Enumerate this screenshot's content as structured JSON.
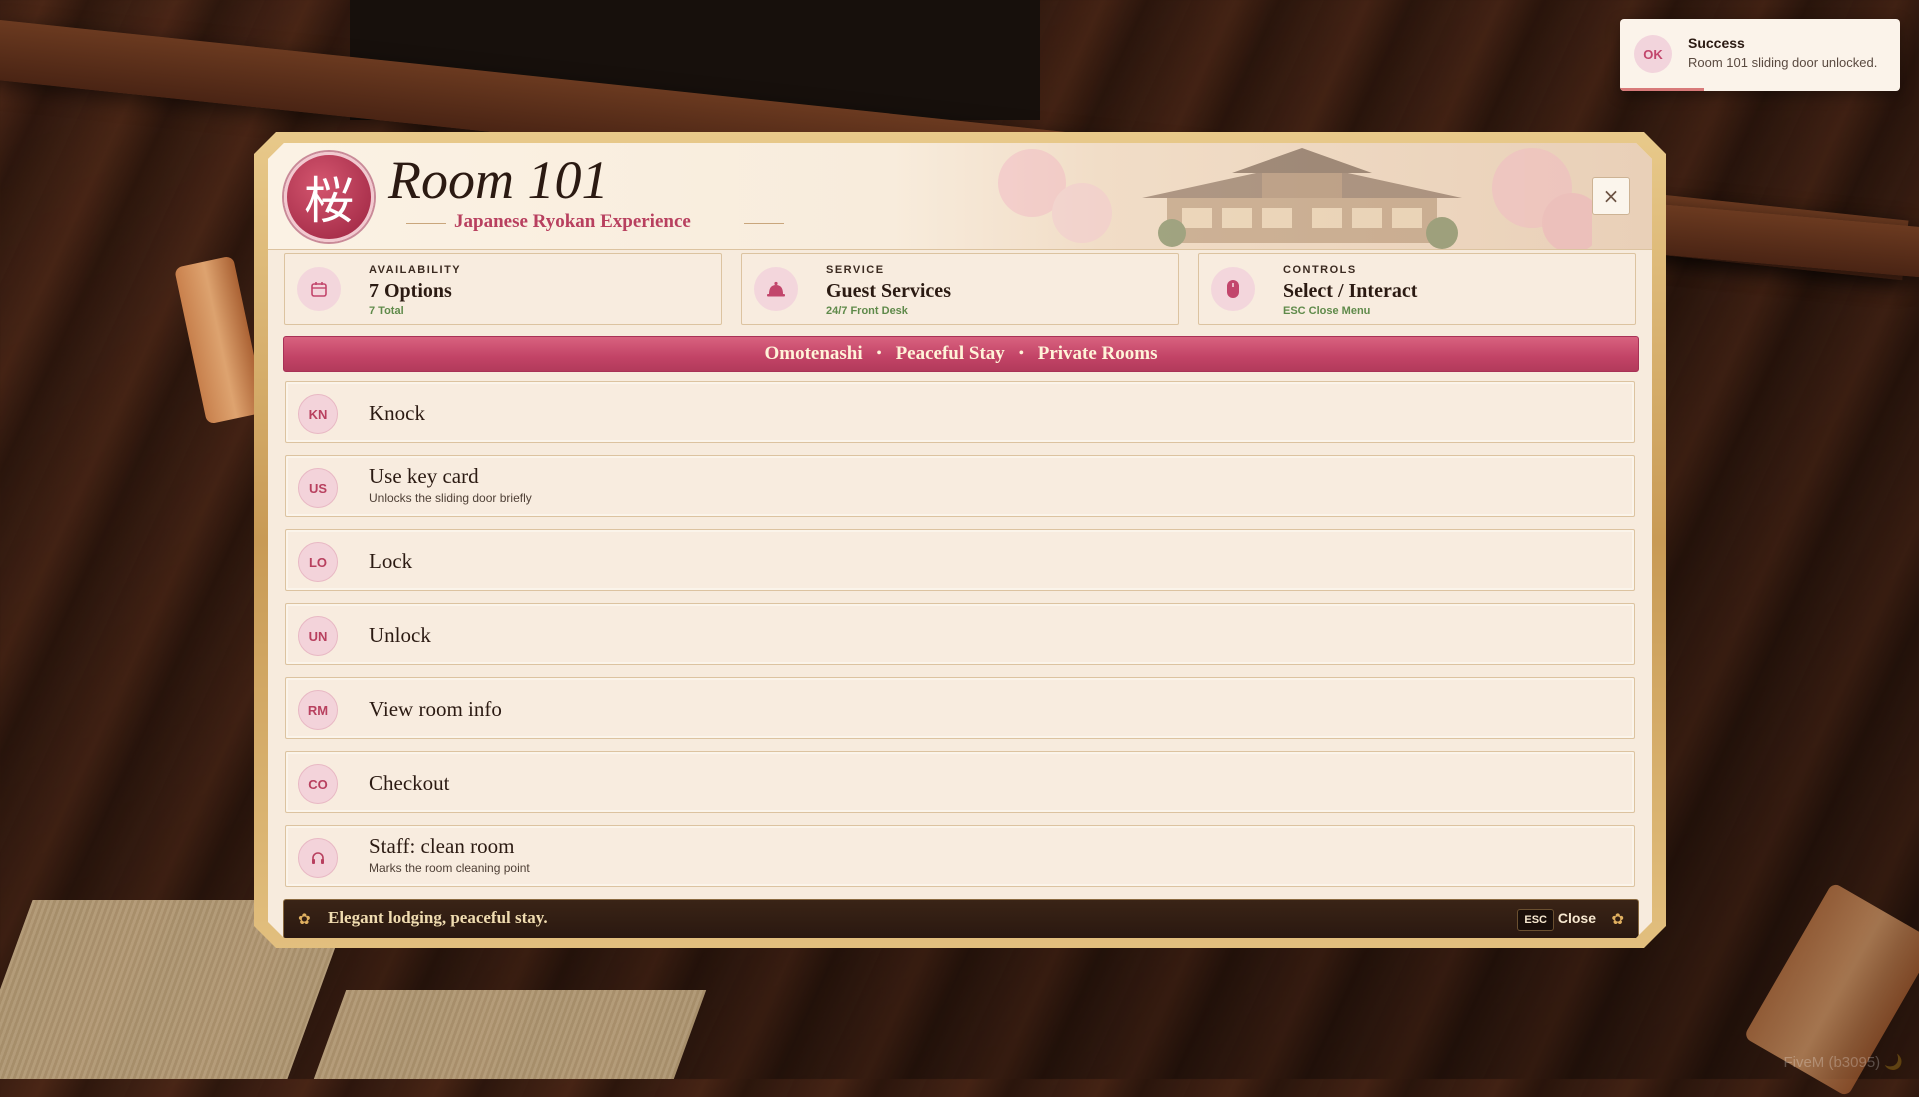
{
  "toast": {
    "badge": "OK",
    "title": "Success",
    "message": "Room 101 sliding door unlocked.",
    "progress_fraction": 0.3
  },
  "header": {
    "emblem": "桜",
    "title": "Room 101",
    "subtitle": "Japanese Ryokan Experience",
    "close_icon": "×"
  },
  "stats": [
    {
      "label": "AVAILABILITY",
      "value": "7 Options",
      "sub": "7 Total",
      "icon": "calendar-icon"
    },
    {
      "label": "SERVICE",
      "value": "Guest Services",
      "sub": "24/7 Front Desk",
      "icon": "bell-icon"
    },
    {
      "label": "CONTROLS",
      "value": "Select / Interact",
      "sub": "ESC Close Menu",
      "icon": "mouse-icon"
    }
  ],
  "ribbon": {
    "items": [
      "Omotenashi",
      "Peaceful Stay",
      "Private Rooms"
    ],
    "separator": "•"
  },
  "menu": [
    {
      "badge": "KN",
      "label": "Knock",
      "desc": ""
    },
    {
      "badge": "US",
      "label": "Use key card",
      "desc": "Unlocks the sliding door briefly"
    },
    {
      "badge": "LO",
      "label": "Lock",
      "desc": ""
    },
    {
      "badge": "UN",
      "label": "Unlock",
      "desc": ""
    },
    {
      "badge": "RM",
      "label": "View room info",
      "desc": ""
    },
    {
      "badge": "CO",
      "label": "Checkout",
      "desc": ""
    },
    {
      "badge": "",
      "label": "Staff: clean room",
      "desc": "Marks the room cleaning point",
      "icon": "headset-icon"
    }
  ],
  "footer": {
    "text": "Elegant lodging, peaceful stay.",
    "esc_key": "ESC",
    "close_label": "Close"
  },
  "watermark": "FiveM (b3095) 🌙",
  "colors": {
    "accent": "#c24366",
    "panel_bg": "#f7ebdd",
    "frame_gold": "#c89a55",
    "success_green": "#5f8a4a"
  }
}
